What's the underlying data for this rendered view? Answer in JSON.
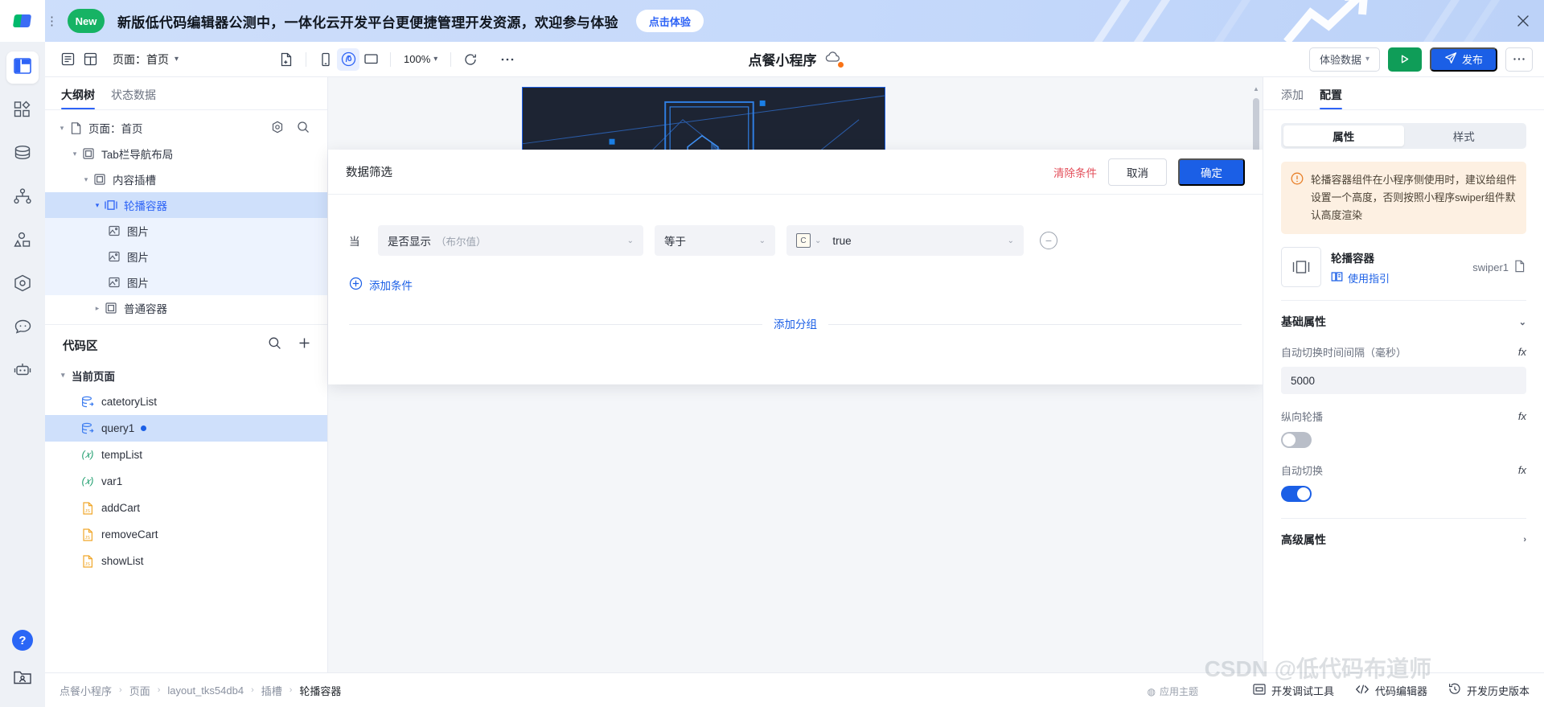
{
  "banner": {
    "badge": "New",
    "message": "新版低代码编辑器公测中，一体化云开发平台更便捷管理开发资源，欢迎参与体验",
    "cta": "点击体验",
    "close_icon": "close-icon"
  },
  "rail": {
    "items": [
      {
        "name": "layout-icon",
        "label": "页面布局"
      },
      {
        "name": "components-icon",
        "label": "组件"
      },
      {
        "name": "database-icon",
        "label": "数据源"
      },
      {
        "name": "flow-icon",
        "label": "流程"
      },
      {
        "name": "assets-icon",
        "label": "素材"
      },
      {
        "name": "settings-hex-icon",
        "label": "设置"
      },
      {
        "name": "chat-icon",
        "label": "反馈"
      },
      {
        "name": "robot-icon",
        "label": "AI助手"
      }
    ],
    "help": "?",
    "account_icon": "account-folder-icon"
  },
  "toolbar": {
    "left_icons": [
      "outline-panel-icon",
      "grid-panel-icon"
    ],
    "page_label": "页面：首页",
    "mid_icons": [
      "new-page-icon",
      "mobile-preview-icon",
      "miniprogram-preview-icon",
      "desktop-preview-icon"
    ],
    "zoom": "100%",
    "refresh_icon": "refresh-icon",
    "more_icon": "more-dots-icon",
    "title": "点餐小程序",
    "cloud_icon": "cloud-status-icon",
    "experience_data": "体验数据",
    "run_icon": "run-play-icon",
    "publish": "发布",
    "more_label": "···"
  },
  "left_panel": {
    "tabs": [
      {
        "label": "大纲树",
        "active": true
      },
      {
        "label": "状态数据",
        "active": false
      }
    ],
    "tree": [
      {
        "label": "页面：首页",
        "depth": 0,
        "caret": "▾",
        "icon": "page-icon",
        "selected": false,
        "header": true
      },
      {
        "label": "Tab栏导航布局",
        "depth": 1,
        "caret": "▾",
        "icon": "layout-box-icon",
        "selected": false
      },
      {
        "label": "内容插槽",
        "depth": 2,
        "caret": "▾",
        "icon": "layout-box-icon",
        "selected": false
      },
      {
        "label": "轮播容器",
        "depth": 3,
        "caret": "▾",
        "icon": "swiper-icon",
        "selected": true
      },
      {
        "label": "图片",
        "depth": 4,
        "caret": "",
        "icon": "image-icon",
        "selected": false,
        "highlight": true
      },
      {
        "label": "图片",
        "depth": 4,
        "caret": "",
        "icon": "image-icon",
        "selected": false,
        "highlight": true
      },
      {
        "label": "图片",
        "depth": 4,
        "caret": "",
        "icon": "image-icon",
        "selected": false,
        "highlight": true
      },
      {
        "label": "普通容器",
        "depth": 3,
        "caret": "▸",
        "icon": "layout-box-icon",
        "selected": false
      }
    ],
    "tree_header_icons": [
      "settings-gear-icon",
      "search-icon"
    ],
    "code_section": {
      "title": "代码区",
      "actions": [
        "search-icon",
        "add-icon"
      ],
      "group_label": "当前页面",
      "items": [
        {
          "label": "catetoryList",
          "type": "query",
          "selected": false,
          "dot": false
        },
        {
          "label": "query1",
          "type": "query",
          "selected": true,
          "dot": true
        },
        {
          "label": "tempList",
          "type": "var",
          "selected": false,
          "dot": false
        },
        {
          "label": "var1",
          "type": "var",
          "selected": false,
          "dot": false
        },
        {
          "label": "addCart",
          "type": "js",
          "selected": false,
          "dot": false
        },
        {
          "label": "removeCart",
          "type": "js",
          "selected": false,
          "dot": false
        },
        {
          "label": "showList",
          "type": "js",
          "selected": false,
          "dot": false
        }
      ]
    }
  },
  "modal": {
    "title": "数据筛选",
    "clear": "清除条件",
    "cancel": "取消",
    "confirm": "确定",
    "when_label": "当",
    "condition": {
      "field": "是否显示",
      "field_type": "（布尔值）",
      "operator": "等于",
      "value_badge": "C",
      "value": "true",
      "remove_icon": "minus-circle-icon"
    },
    "add_condition": "添加条件",
    "add_group": "添加分组"
  },
  "right_panel": {
    "tabs": [
      {
        "label": "添加",
        "active": false
      },
      {
        "label": "配置",
        "active": true
      }
    ],
    "segments": [
      {
        "label": "属性",
        "active": true
      },
      {
        "label": "样式",
        "active": false
      }
    ],
    "tip": "轮播容器组件在小程序侧使用时，建议给组件设置一个高度，否则按照小程序swiper组件默认高度渲染",
    "component": {
      "icon": "swiper-icon",
      "name": "轮播容器",
      "guide": "使用指引",
      "guide_icon": "book-icon",
      "id": "swiper1",
      "copy_icon": "copy-icon"
    },
    "basic_section": {
      "title": "基础属性",
      "collapse_icon": "chevron-down-icon",
      "props": [
        {
          "label": "自动切换时间间隔（毫秒）",
          "type": "input",
          "value": "5000",
          "fx": "fx"
        },
        {
          "label": "纵向轮播",
          "type": "switch",
          "on": false,
          "fx": "fx"
        },
        {
          "label": "自动切换",
          "type": "switch",
          "on": true,
          "fx": "fx"
        }
      ]
    },
    "advanced_section": {
      "title": "高级属性",
      "expand_icon": "chevron-right-icon"
    }
  },
  "status_bar": {
    "breadcrumb": [
      "点餐小程序",
      "页面",
      "layout_tks54db4",
      "插槽",
      "轮播容器"
    ],
    "items": [
      {
        "label": "开发调试工具",
        "icon": "devtools-icon"
      },
      {
        "label": "代码编辑器",
        "icon": "code-brackets-icon"
      },
      {
        "label": "开发历史版本",
        "icon": "history-icon"
      }
    ],
    "theme_chip": "应用主题"
  },
  "watermark": "CSDN @低代码布道师",
  "colors": {
    "primary": "#1b5fe6",
    "danger": "#e34d59",
    "success": "#0f9d58",
    "warn": "#e8802a",
    "selection": "#cfe0fb"
  }
}
